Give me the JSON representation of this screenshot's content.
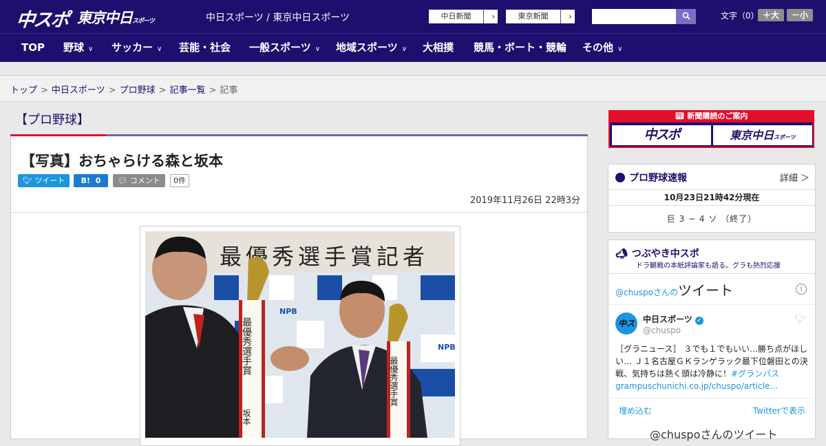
{
  "header": {
    "logo_main": "中スポ",
    "logo_tokyo": "東京中日",
    "logo_tokyo_small": "スポーツ",
    "site_name": "中日スポーツ / 東京中日スポーツ",
    "newspaper_links": [
      {
        "label": "中日新聞"
      },
      {
        "label": "東京新聞"
      }
    ],
    "search": {
      "placeholder": "",
      "value": ""
    },
    "font_size_label": "文字（0）",
    "font_bigger": "＋大",
    "font_smaller": "－小",
    "colors": {
      "header_bg": "#1c0f6e",
      "accent_red": "#e30e28",
      "search_button": "#7c6ec3"
    }
  },
  "nav": {
    "items": [
      {
        "label": "TOP",
        "dropdown": false
      },
      {
        "label": "野球",
        "dropdown": true
      },
      {
        "label": "サッカー",
        "dropdown": true
      },
      {
        "label": "芸能・社会",
        "dropdown": false
      },
      {
        "label": "一般スポーツ",
        "dropdown": true
      },
      {
        "label": "地域スポーツ",
        "dropdown": true
      },
      {
        "label": "大相撲",
        "dropdown": false
      },
      {
        "label": "競馬・ボート・競輪",
        "dropdown": false
      },
      {
        "label": "その他",
        "dropdown": true
      }
    ]
  },
  "breadcrumb": {
    "items": [
      "トップ",
      "中日スポーツ",
      "プロ野球",
      "記事一覧",
      "記事"
    ],
    "separator": ">"
  },
  "section": {
    "title": "【プロ野球】"
  },
  "article": {
    "headline": "【写真】おちゃらける森と坂本",
    "share": {
      "tweet_label": "ツイート",
      "hatena_label": "B!",
      "hatena_count": "0",
      "comment_label": "コメント",
      "comment_count": "0件"
    },
    "date": "2019年11月26日 22時3分",
    "photo": {
      "banner_text": "最優秀選手賞記者",
      "sponsor_text": "NPB",
      "sash_left": "最優秀選手賞",
      "sash_name": "坂本",
      "sash_right": "最優秀選手賞"
    }
  },
  "sidebar": {
    "subscription": {
      "header": "新聞購読のご案内",
      "logo1": "中スポ",
      "logo2": "東京中日",
      "logo2_small": "スポーツ"
    },
    "score": {
      "title": "プロ野球速報",
      "more": "詳細 ＞",
      "as_of": "10月23日21時42分現在",
      "result": "巨 3 − 4 ソ （終了）"
    },
    "twitter": {
      "title": "つぶやき中スポ",
      "subtitle": "ドラ観戦の本紙評論家も語る。グラも熱烈応援",
      "timeline_prefix": "@chuspoさんの",
      "timeline_word": "ツイート",
      "account_name": "中日スポーツ",
      "account_handle": "@chuspo",
      "avatar_text": "中スポ",
      "tweet_text": "［グラニュース］ ３でも１でもいい…勝ち点がほしい… Ｊ１名古屋ＧＫランゲラック最下位磐田との決戦、気持ちは熱く頭は冷静に！",
      "tweet_link1": "#グランパス",
      "tweet_link2": "grampuschunichi.co.jp/chuspo/article…",
      "embed_label": "埋め込む",
      "view_label": "Twitterで表示",
      "footer_text": "@chuspoさんのツイート"
    }
  }
}
